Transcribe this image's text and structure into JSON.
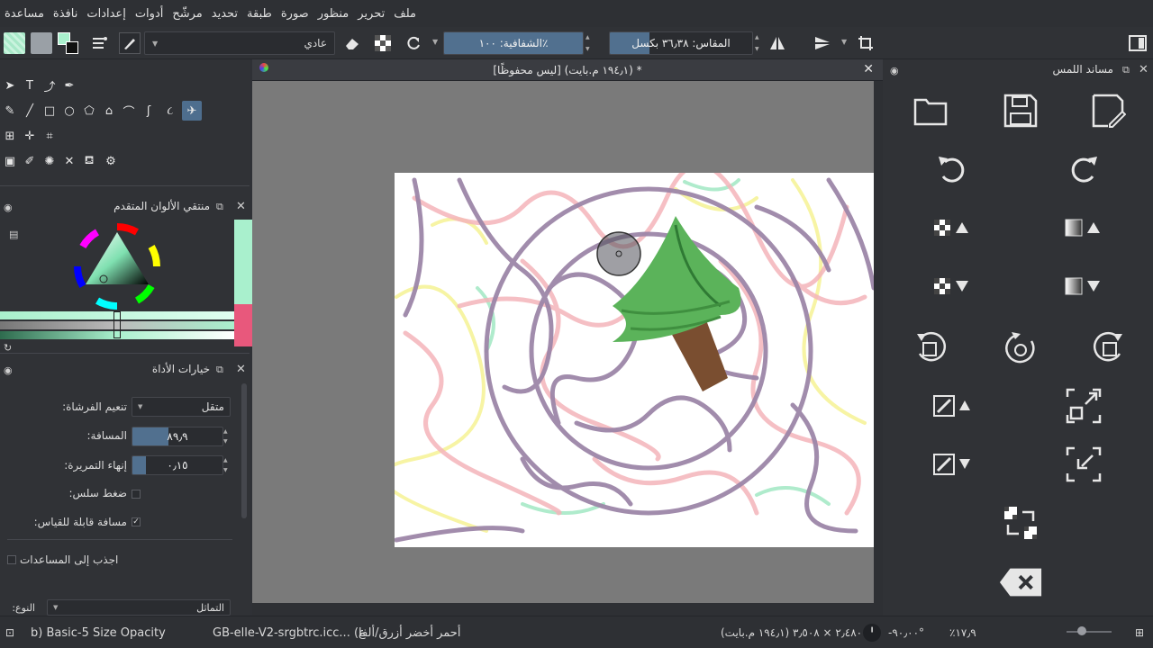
{
  "menu": [
    "ملف",
    "تحرير",
    "منظور",
    "صورة",
    "طبقة",
    "تحديد",
    "مرشّح",
    "أدوات",
    "إعدادات",
    "نافذة",
    "مساعدة"
  ],
  "toolbar": {
    "blend_mode": "عادي",
    "opacity_text": "٪الشفافية: ١٠٠",
    "opacity_fraction": 1.0,
    "size_text": "المقاس: ٣٦٫٣٨ بكسل",
    "size_fraction": 0.28,
    "colors": {
      "fg": "#1a1a1a",
      "bg": "#ffffff",
      "swatch_a": "#a8e8c8",
      "swatch_b": "#9aa0a6"
    }
  },
  "document_tab": {
    "title": "* (١٩٤٫١ م.بايت)  [ليس محفوظًا]"
  },
  "color_selector": {
    "title": "منتقي الألوان المتقدم",
    "current_color": "#a9f0cd",
    "previous_color": "#e8587c",
    "secondary_color": "#bfeed8"
  },
  "tool_options": {
    "title": "خيارات الأداة",
    "smoothing_label": "تنعيم الفرشاة:",
    "smoothing_value": "متقل",
    "distance_label": "المسافة:",
    "distance_value": "٨٩٫٩",
    "distance_fraction": 0.4,
    "stroke_end_label": "إنهاء التمريرة:",
    "stroke_end_value": "٠٫١٥",
    "stroke_end_fraction": 0.15,
    "pressure_label": "ضغط سلس:",
    "scalable_label": "مسافة قابلة للقياس:",
    "snap_label": "اجذب إلى المساعدات",
    "bottom_label": "النوع:",
    "bottom_value": "التماثل"
  },
  "touch_docker": {
    "title": "مساند اللمس"
  },
  "statusbar": {
    "preset": "b) Basic-5 Size Opacity",
    "color_space": "GB-elle-V2-srgbtrc.icc... (ع",
    "channels": "أحمر أخضر أزرق/ألفا",
    "image_size": "٢٫٤٨٠ × ٣٫٥٠٨ (١٩٤٫١ م.بايت)",
    "rotation": "-٩٠٫٠٠°",
    "zoom": "٪١٧٫٩"
  },
  "icons": {
    "open": "folder-icon",
    "save": "save-icon",
    "save_as": "save-as-icon",
    "undo": "undo-icon",
    "redo": "redo-icon"
  }
}
